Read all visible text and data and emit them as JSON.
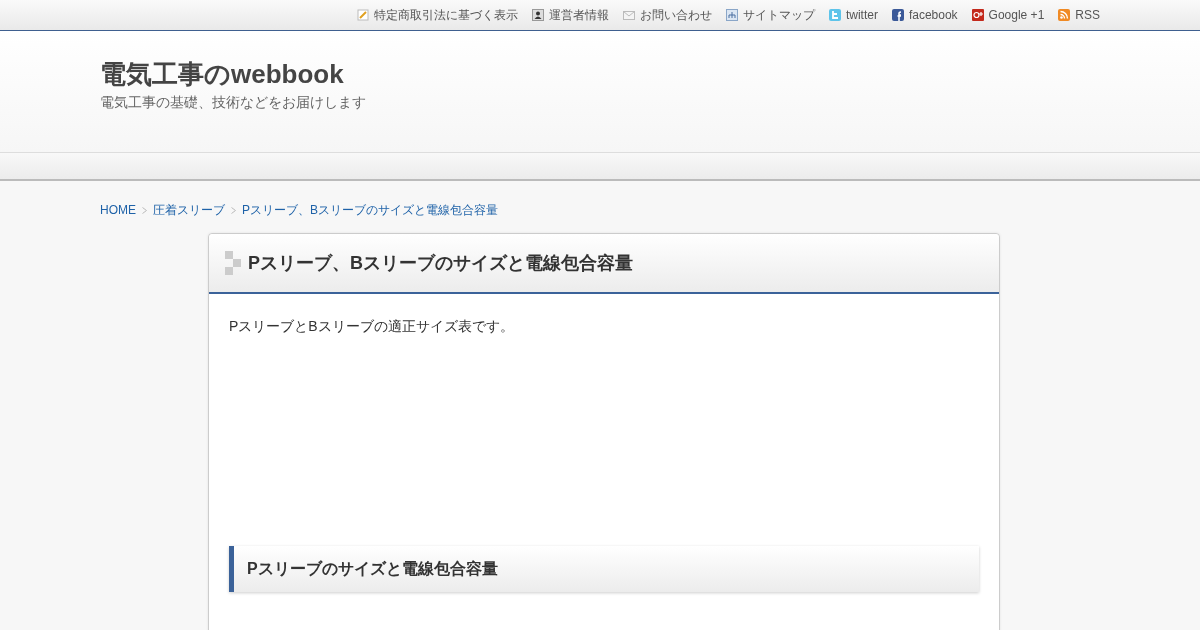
{
  "top_links": [
    {
      "kind": "memo",
      "label": "特定商取引法に基づく表示"
    },
    {
      "kind": "person",
      "label": "運営者情報"
    },
    {
      "kind": "mail",
      "label": "お問い合わせ"
    },
    {
      "kind": "sitemap",
      "label": "サイトマップ"
    },
    {
      "kind": "twitter",
      "label": "twitter"
    },
    {
      "kind": "facebook",
      "label": "facebook"
    },
    {
      "kind": "google",
      "label": "Google +1"
    },
    {
      "kind": "rss",
      "label": "RSS"
    }
  ],
  "site": {
    "title": "電気工事のwebbook",
    "tagline": "電気工事の基礎、技術などをお届けします"
  },
  "breadcrumb": [
    {
      "label": "HOME"
    },
    {
      "label": "圧着スリーブ"
    },
    {
      "label": "Pスリーブ、Bスリーブのサイズと電線包合容量"
    }
  ],
  "article": {
    "title": "Pスリーブ、Bスリーブのサイズと電線包合容量",
    "intro": "PスリーブとBスリーブの適正サイズ表です。",
    "heading": "Pスリーブのサイズと電線包合容量"
  }
}
